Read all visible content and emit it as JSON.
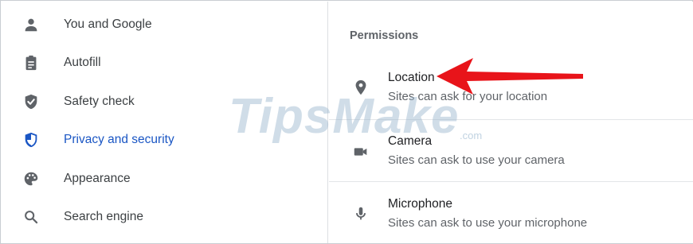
{
  "sidebar": {
    "items": [
      {
        "label": "You and Google",
        "icon": "person-icon"
      },
      {
        "label": "Autofill",
        "icon": "clipboard-icon"
      },
      {
        "label": "Safety check",
        "icon": "shield-check-icon"
      },
      {
        "label": "Privacy and security",
        "icon": "shield-icon",
        "active": true
      },
      {
        "label": "Appearance",
        "icon": "palette-icon"
      },
      {
        "label": "Search engine",
        "icon": "search-icon"
      }
    ]
  },
  "content": {
    "section_title": "Permissions",
    "permissions": [
      {
        "title": "Location",
        "subtitle": "Sites can ask for your location",
        "icon": "location-pin-icon"
      },
      {
        "title": "Camera",
        "subtitle": "Sites can ask to use your camera",
        "icon": "camera-icon"
      },
      {
        "title": "Microphone",
        "subtitle": "Sites can ask to use your microphone",
        "icon": "microphone-icon"
      }
    ]
  },
  "watermark": {
    "text": "TipsMake",
    "suffix": ".com"
  },
  "colors": {
    "accent_blue": "#1a56c4",
    "text_primary": "#202124",
    "text_secondary": "#5f6368",
    "icon_gray": "#5f6368",
    "arrow_red": "#e8141a"
  }
}
